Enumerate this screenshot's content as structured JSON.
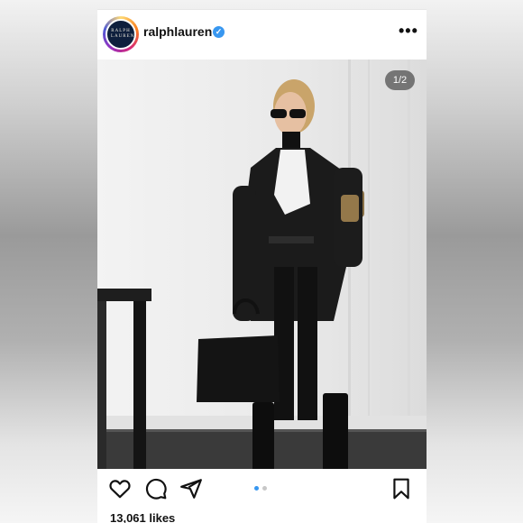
{
  "post": {
    "username": "ralphlauren",
    "verified_icon": "verified-badge-icon",
    "avatar_text": "RALPH LAUREN",
    "more_label": "•••",
    "photo_counter": "1/2",
    "likes": "13,061 likes",
    "carousel_active_index": 1,
    "carousel_total": 2
  },
  "actions": {
    "like_icon": "heart-icon",
    "comment_icon": "comment-icon",
    "share_icon": "send-icon",
    "save_icon": "bookmark-icon"
  },
  "colors": {
    "verified": "#3897f0",
    "dot_active": "#3897f0",
    "dot_inactive": "#c7c7c7",
    "avatar_bg": "#0e1f3d"
  }
}
